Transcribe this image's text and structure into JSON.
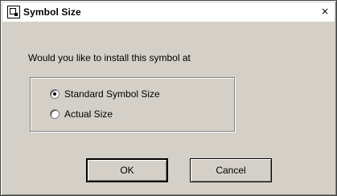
{
  "window": {
    "title": "Symbol Size",
    "icon": "app-icon",
    "close_glyph": "×"
  },
  "dialog": {
    "prompt": "Would you like to install this symbol at",
    "options": [
      {
        "label": "Standard Symbol Size",
        "selected": true
      },
      {
        "label": "Actual Size",
        "selected": false
      }
    ]
  },
  "buttons": {
    "ok_label": "OK",
    "cancel_label": "Cancel"
  }
}
